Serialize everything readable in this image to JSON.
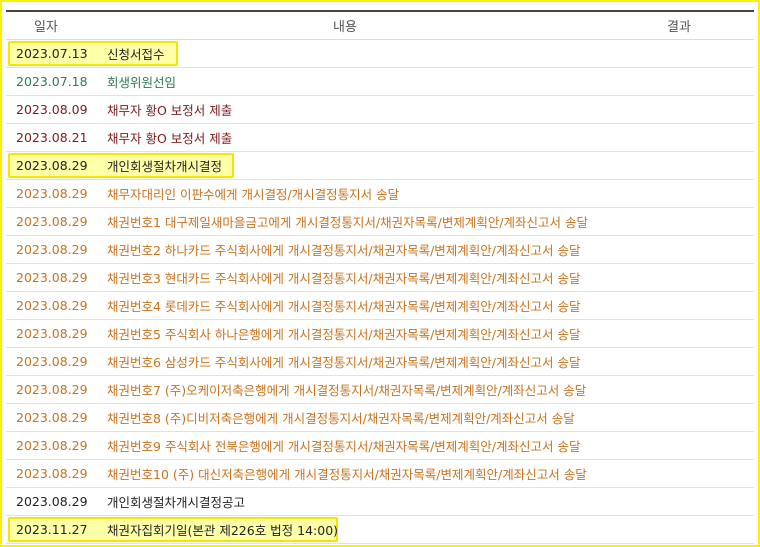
{
  "table": {
    "headers": {
      "date": "일자",
      "content": "내용",
      "result": "결과"
    },
    "rows": [
      {
        "date": "2023.07.13",
        "content": "신청서접수",
        "color": "#222222",
        "highlight": true,
        "hlw": 166
      },
      {
        "date": "2023.07.18",
        "content": "회생위원선임",
        "color": "#2e7a52",
        "highlight": false
      },
      {
        "date": "2023.08.09",
        "content": "채무자 황O 보정서 제출",
        "color": "#7a1c1c",
        "highlight": false
      },
      {
        "date": "2023.08.21",
        "content": "채무자 황O 보정서 제출",
        "color": "#7a1c1c",
        "highlight": false
      },
      {
        "date": "2023.08.29",
        "content": "개인회생절차개시결정",
        "color": "#222222",
        "highlight": true,
        "hlw": 222
      },
      {
        "date": "2023.08.29",
        "content": "채무자대리인 이판수에게 개시결정/개시결정통지서 송달",
        "color": "#c8731e",
        "highlight": false
      },
      {
        "date": "2023.08.29",
        "content": "채권번호1 대구제일새마을금고에게 개시결정통지서/채권자목록/변제계획안/계좌신고서 송달",
        "color": "#c8731e",
        "highlight": false
      },
      {
        "date": "2023.08.29",
        "content": "채권번호2 하나카드 주식회사에게 개시결정통지서/채권자목록/변제계획안/계좌신고서 송달",
        "color": "#c8731e",
        "highlight": false
      },
      {
        "date": "2023.08.29",
        "content": "채권번호3 현대카드 주식회사에게 개시결정통지서/채권자목록/변제계획안/계좌신고서 송달",
        "color": "#c8731e",
        "highlight": false
      },
      {
        "date": "2023.08.29",
        "content": "채권번호4 롯데카드 주식회사에게 개시결정통지서/채권자목록/변제계획안/계좌신고서 송달",
        "color": "#c8731e",
        "highlight": false
      },
      {
        "date": "2023.08.29",
        "content": "채권번호5 주식회사 하나은행에게 개시결정통지서/채권자목록/변제계획안/계좌신고서 송달",
        "color": "#c8731e",
        "highlight": false
      },
      {
        "date": "2023.08.29",
        "content": "채권번호6 삼성카드 주식회사에게 개시결정통지서/채권자목록/변제계획안/계좌신고서 송달",
        "color": "#c8731e",
        "highlight": false
      },
      {
        "date": "2023.08.29",
        "content": "채권번호7 (주)오케이저축은행에게 개시결정통지서/채권자목록/변제계획안/계좌신고서 송달",
        "color": "#c8731e",
        "highlight": false
      },
      {
        "date": "2023.08.29",
        "content": "채권번호8 (주)디비저축은행에게 개시결정통지서/채권자목록/변제계획안/계좌신고서 송달",
        "color": "#c8731e",
        "highlight": false
      },
      {
        "date": "2023.08.29",
        "content": "채권번호9 주식회사 전북은행에게 개시결정통지서/채권자목록/변제계획안/계좌신고서 송달",
        "color": "#c8731e",
        "highlight": false
      },
      {
        "date": "2023.08.29",
        "content": "채권번호10 (주) 대신저축은행에게 개시결정통지서/채권자목록/변제계획안/계좌신고서 송달",
        "color": "#c8731e",
        "highlight": false
      },
      {
        "date": "2023.08.29",
        "content": "개인회생절차개시결정공고",
        "color": "#222222",
        "highlight": false
      },
      {
        "date": "2023.11.27",
        "content": "채권자집회기일(본관 제226호 법정 14:00)",
        "color": "#222222",
        "highlight": true,
        "hlw": 326
      }
    ]
  }
}
